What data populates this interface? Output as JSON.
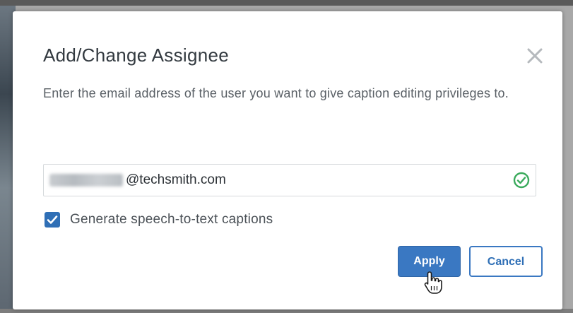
{
  "dialog": {
    "title": "Add/Change Assignee",
    "description": "Enter the email address of the user you want to give caption editing privileges to.",
    "close_icon": "close-icon"
  },
  "email": {
    "visible_value": "@techsmith.com",
    "status_icon": "check-circle-icon",
    "status_color": "#3aaa5c"
  },
  "option": {
    "label": "Generate speech-to-text captions",
    "checked": true
  },
  "buttons": {
    "apply": "Apply",
    "cancel": "Cancel"
  },
  "colors": {
    "accent": "#3a78c2",
    "title_text": "#333a40",
    "body_text": "#5a6066"
  }
}
